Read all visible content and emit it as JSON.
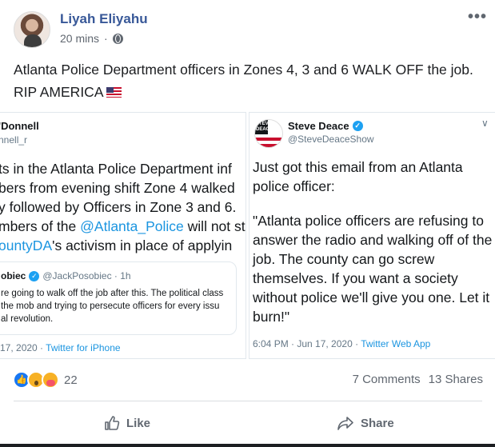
{
  "post": {
    "author": "Liyah Eliyahu",
    "time": "20 mins",
    "privacy_icon": "globe-icon",
    "more_icon": "•••",
    "text_line1": "Atlanta Police Department officers in Zones 4, 3 and 6 WALK OFF the job.",
    "text_line2": "RIP AMERICA"
  },
  "left_tweet": {
    "name": "'Donnell",
    "handle": "nnell_r",
    "lines": [
      "ts in the Atlanta Police Department inf",
      "bers from evening shift Zone 4 walked",
      "y followed by Officers in Zone 3 and 6.",
      "mbers of the ",
      "ountyDA",
      "'s activism in place of applyin"
    ],
    "link1": "@Atlanta_Police",
    "after_link1": " will not st",
    "quote": {
      "name": "obiec",
      "handle": "@JackPosobiec · 1h",
      "lines": [
        "re going to walk off the job after this. The political class",
        " the mob and trying to persecute officers for every issu",
        "al revolution."
      ]
    },
    "date": "17, 2020 · ",
    "source": "Twitter for iPhone"
  },
  "right_tweet": {
    "avatar_text": "STEVE DEACE",
    "name": "Steve Deace",
    "handle": "@SteveDeaceShow",
    "chevron": "∨",
    "para1": "Just got this email from an Atlanta police officer:",
    "para2": "\"Atlanta police officers are refusing to answer the radio and walking off of the job. The county can go screw themselves. If you want a society without police we'll give you one. Let it burn!\"",
    "date": "6:04 PM · Jun 17, 2020 · ",
    "source": "Twitter Web App"
  },
  "footer": {
    "reaction_count": "22",
    "comments": "7 Comments",
    "shares": "13 Shares",
    "like_label": "Like",
    "share_label": "Share"
  },
  "colors": {
    "author": "#385898",
    "link": "#1b95e0",
    "muted": "#606770"
  }
}
